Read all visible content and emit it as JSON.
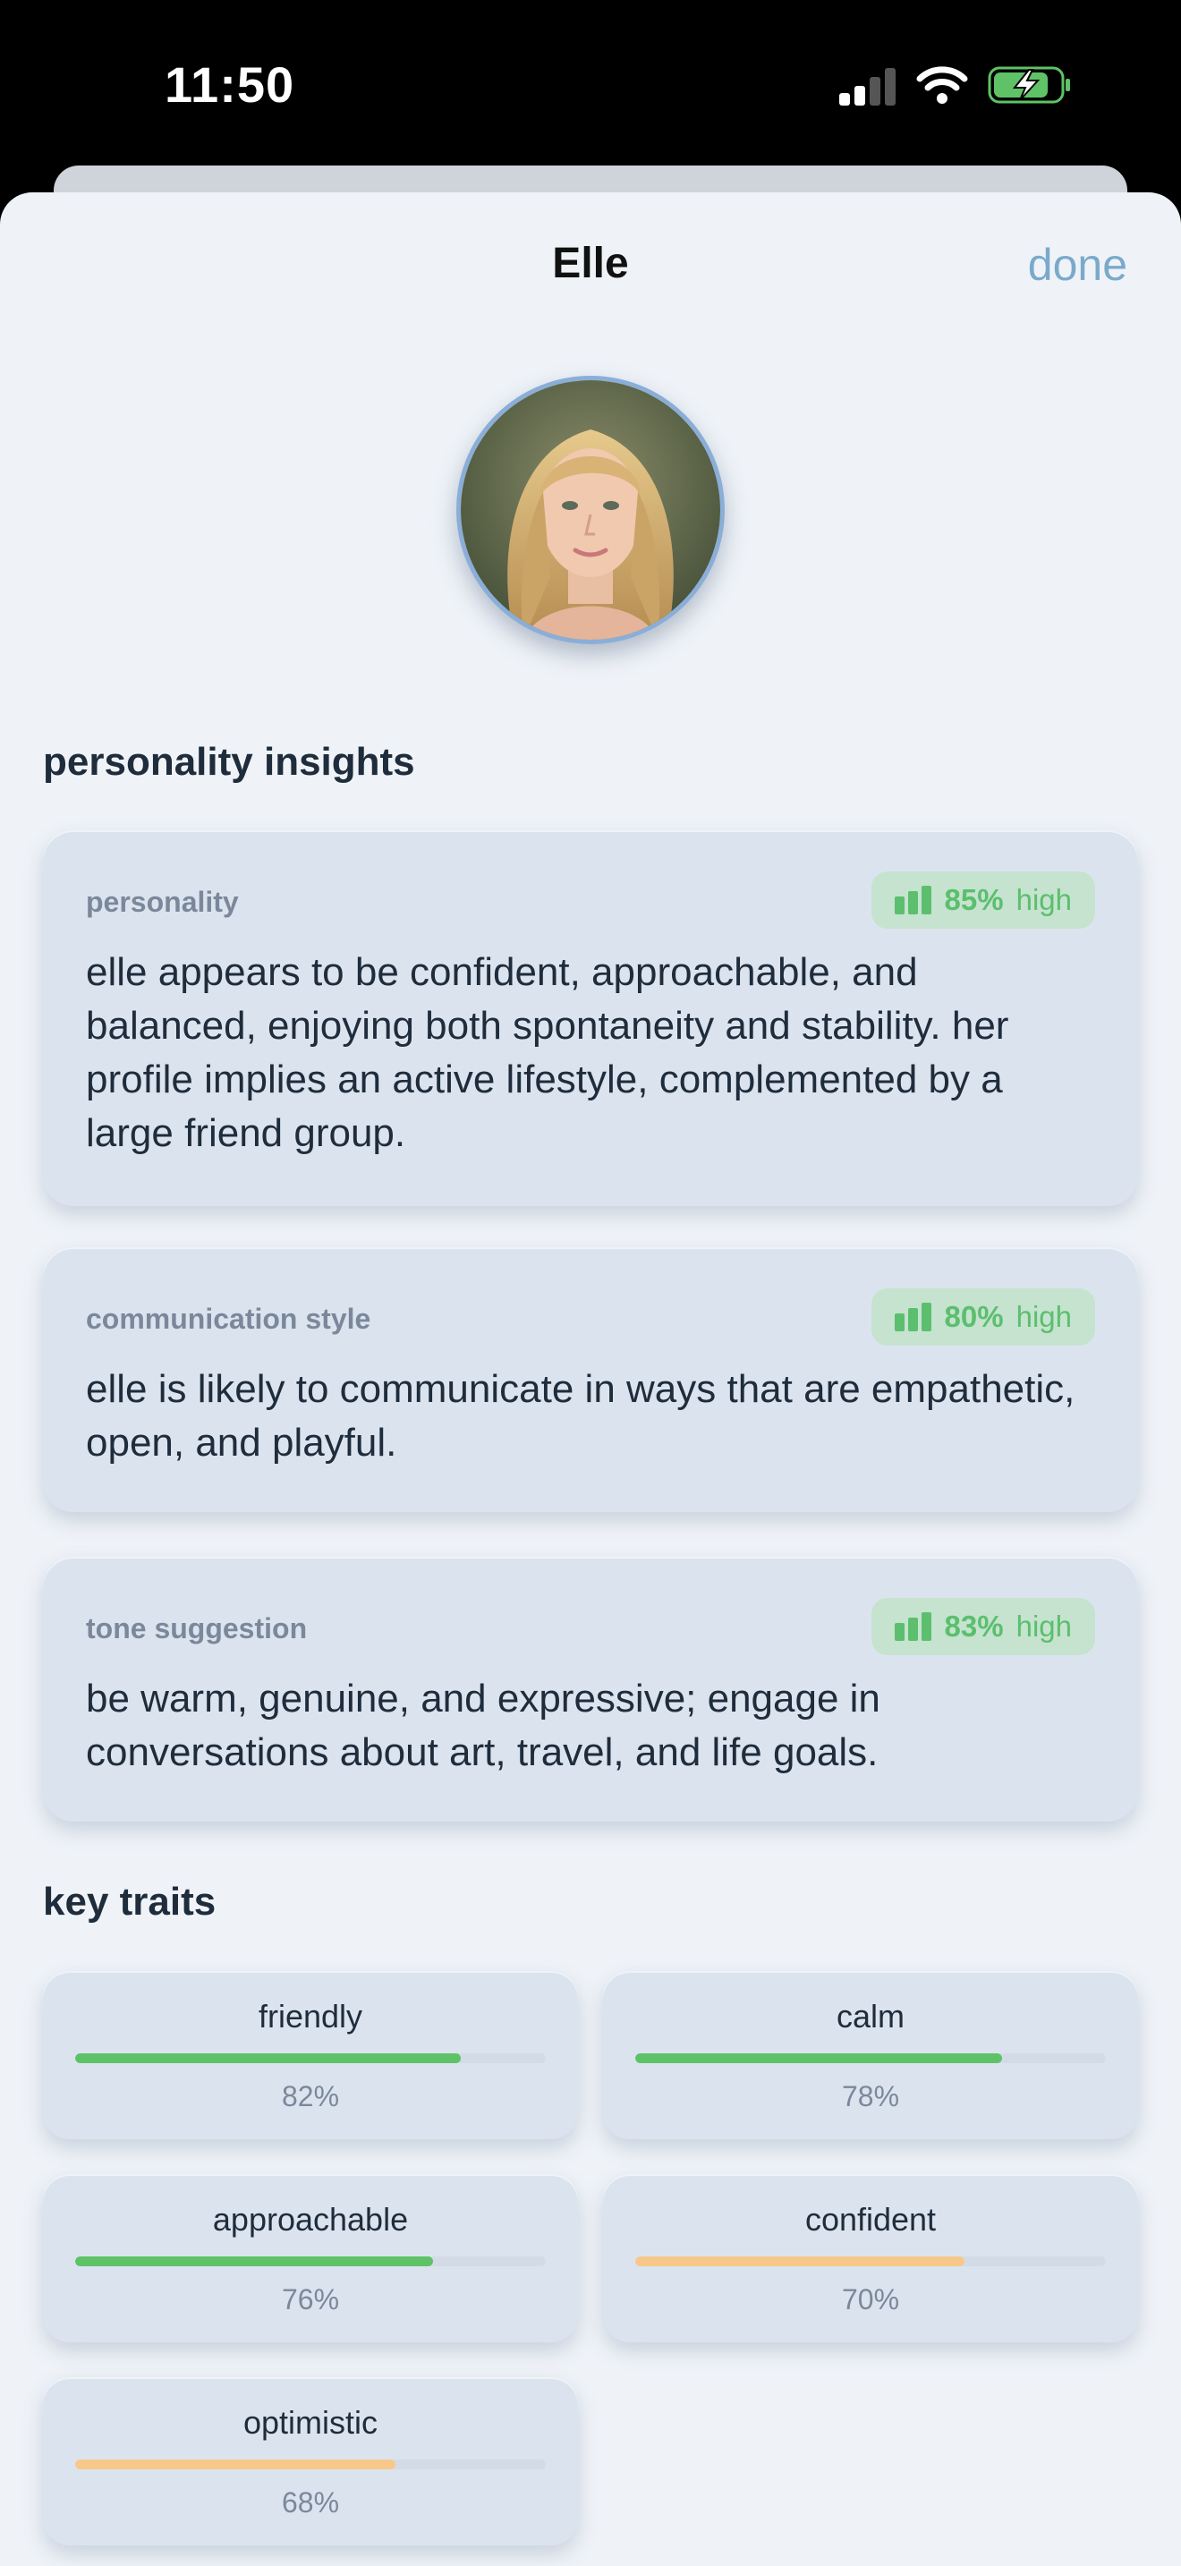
{
  "status_bar": {
    "time": "11:50"
  },
  "header": {
    "title": "Elle",
    "done_label": "done"
  },
  "avatar": {
    "alt": "Elle"
  },
  "sections": {
    "insights_title": "personality insights",
    "traits_title": "key traits"
  },
  "insights": [
    {
      "label": "personality",
      "percent": "85%",
      "level": "high",
      "text": "elle appears to be confident, approachable, and balanced, enjoying both spontaneity and stability. her profile implies an active lifestyle, complemented by a large friend group."
    },
    {
      "label": "communication style",
      "percent": "80%",
      "level": "high",
      "text": "elle is likely to communicate in ways that are empathetic, open, and playful."
    },
    {
      "label": "tone suggestion",
      "percent": "83%",
      "level": "high",
      "text": "be warm, genuine, and expressive; engage in conversations about art, travel, and life goals."
    }
  ],
  "traits": [
    {
      "name": "friendly",
      "value": "82%",
      "fraction": 0.82,
      "color": "#5fc267"
    },
    {
      "name": "calm",
      "value": "78%",
      "fraction": 0.78,
      "color": "#5fc267"
    },
    {
      "name": "approachable",
      "value": "76%",
      "fraction": 0.76,
      "color": "#5fc267"
    },
    {
      "name": "confident",
      "value": "70%",
      "fraction": 0.7,
      "color": "#f8c88a"
    },
    {
      "name": "optimistic",
      "value": "68%",
      "fraction": 0.68,
      "color": "#f8c88a"
    }
  ],
  "colors": {
    "accent": "#7aaacb",
    "badge_green": "#5bbf6e",
    "badge_bg": "#c5e3cf"
  }
}
